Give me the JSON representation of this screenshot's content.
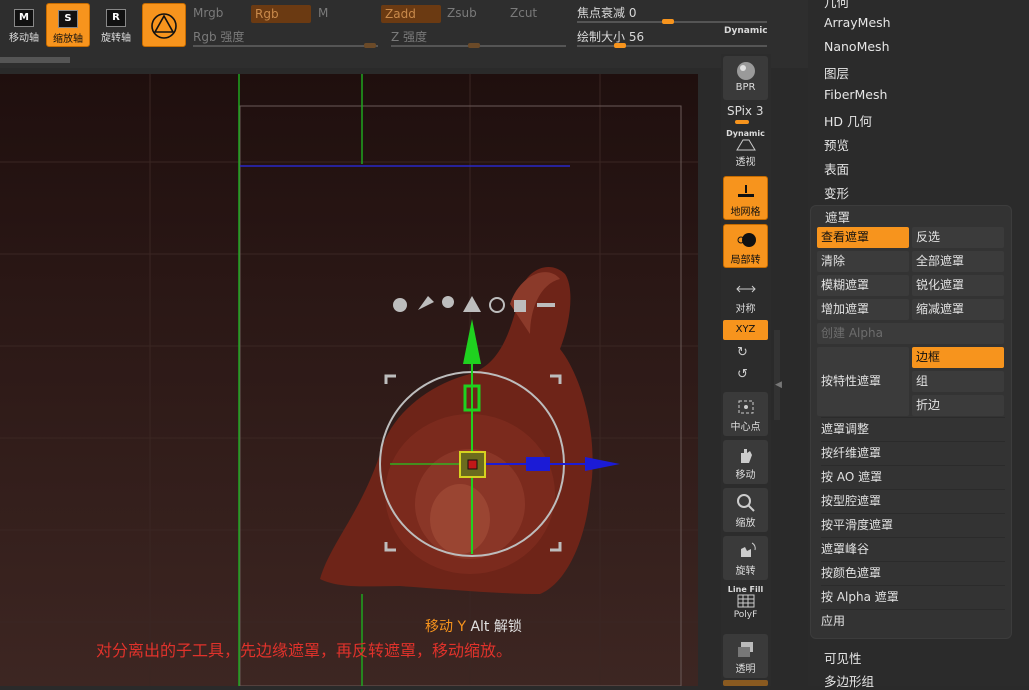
{
  "toolbar": {
    "move_btn": "移动轴",
    "scale_btn": "缩放轴",
    "rotate_btn": "旋转轴",
    "move_key": "M",
    "scale_key": "S",
    "rotate_key": "R",
    "mrgb": "Mrgb",
    "rgb": "Rgb",
    "m": "M",
    "zadd": "Zadd",
    "zsub": "Zsub",
    "zcut": "Zcut",
    "rgb_intensity": "Rgb 强度",
    "z_intensity": "Z 强度",
    "focal_shift": "焦点衰减 0",
    "draw_size": "绘制大小 56",
    "dynamic": "Dynamic"
  },
  "viewport": {
    "gizmo_label": "移动 Y",
    "gizmo_hint": "Alt 解锁",
    "caption": "对分离出的子工具，先边缘遮罩，再反转遮罩，移动缩放。"
  },
  "shelf": {
    "bpr": "BPR",
    "spix": "SPix 3",
    "perspective_top": "Dynamic",
    "perspective": "透视",
    "floor": "地网格",
    "local": "局部转",
    "symmetry": "对称",
    "xyz": "XYZ",
    "center": "中心点",
    "move": "移动",
    "scale": "缩放",
    "rotate": "旋转",
    "linefill_top": "Line Fill",
    "linefill": "PolyF",
    "transp": "透明"
  },
  "panel": {
    "top_cut": "几何",
    "items_top": [
      "ArrayMesh",
      "NanoMesh",
      "图层",
      "FiberMesh",
      "HD 几何",
      "预览",
      "表面",
      "变形"
    ],
    "mask_title": "遮罩",
    "grid": [
      {
        "label": "查看遮罩",
        "active": true
      },
      {
        "label": "反选",
        "active": false
      },
      {
        "label": "清除",
        "active": false
      },
      {
        "label": "全部遮罩",
        "active": false
      },
      {
        "label": "模糊遮罩",
        "active": false
      },
      {
        "label": "锐化遮罩",
        "active": false
      },
      {
        "label": "增加遮罩",
        "active": false
      },
      {
        "label": "缩减遮罩",
        "active": false
      }
    ],
    "create_alpha": "创建 Alpha",
    "by_feature": "按特性遮罩",
    "feature_opts": [
      {
        "label": "边框",
        "active": true
      },
      {
        "label": "组",
        "active": false
      },
      {
        "label": "折边",
        "active": false
      }
    ],
    "rows": [
      "遮罩调整",
      "按纤维遮罩",
      "按 AO 遮罩",
      "按型腔遮罩",
      "按平滑度遮罩",
      "遮罩峰谷",
      "按颜色遮罩",
      "按 Alpha 遮罩",
      "应用"
    ],
    "items_bottom": [
      "可见性",
      "多边形组"
    ]
  },
  "colors": {
    "accent": "#f7941d",
    "caption": "#e0322b",
    "axis_y": "#1fd11f",
    "axis_x": "#1b1bd6"
  }
}
